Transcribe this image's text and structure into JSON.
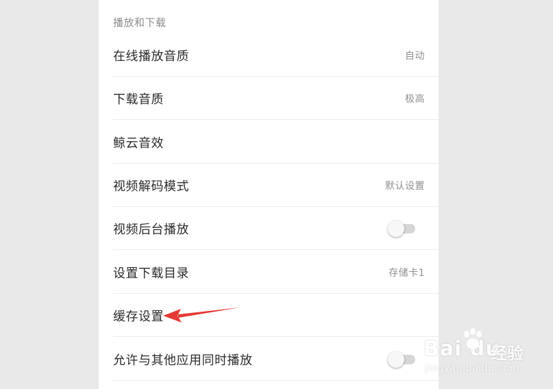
{
  "section": {
    "header": "播放和下载"
  },
  "rows": [
    {
      "label": "在线播放音质",
      "value": "自动"
    },
    {
      "label": "下载音质",
      "value": "极高"
    },
    {
      "label": "鲸云音效",
      "value": ""
    },
    {
      "label": "视频解码模式",
      "value": "默认设置"
    },
    {
      "label": "视频后台播放",
      "toggle": false
    },
    {
      "label": "设置下载目录",
      "value": "存储卡1"
    },
    {
      "label": "缓存设置",
      "value": ""
    },
    {
      "label": "允许与其他应用同时播放",
      "toggle": false
    }
  ],
  "annotation": {
    "arrow_color": "#e53935"
  },
  "watermark": {
    "logo": "Bai  du",
    "suffix": "经验",
    "url": "jingyan.baidu.com"
  }
}
